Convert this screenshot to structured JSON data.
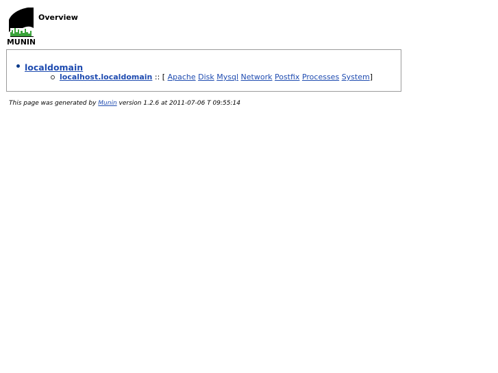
{
  "header": {
    "logo_text": "MUNIN",
    "title": "Overview"
  },
  "tree": {
    "domain": "localdomain",
    "host": "localhost.localdomain",
    "sep_open": ":: [",
    "sep_close": "]",
    "categories": [
      "Apache",
      "Disk",
      "Mysql",
      "Network",
      "Postfix",
      "Processes",
      "System"
    ]
  },
  "footer": {
    "prefix": "This page was generated by",
    "link": "Munin",
    "suffix": "version 1.2.6 at 2011-07-06 T 09:55:14"
  },
  "colors": {
    "link": "#1e4bb0",
    "border": "#9a9a9a"
  }
}
